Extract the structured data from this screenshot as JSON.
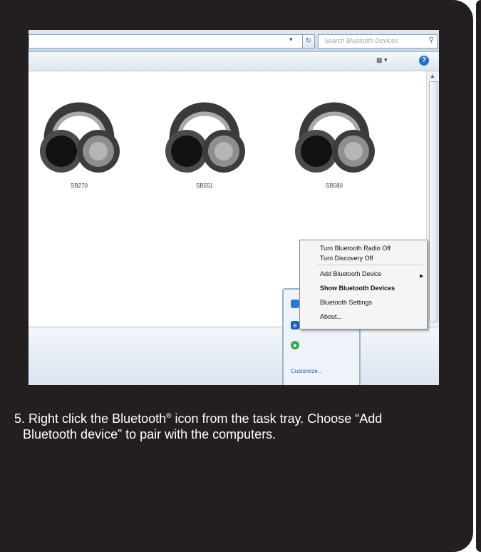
{
  "window": {
    "search_placeholder": "Search Bluetooth Devices",
    "devices": [
      {
        "name": "SB270"
      },
      {
        "name": "SB551"
      },
      {
        "name": "SB580"
      }
    ]
  },
  "context_menu": {
    "items": [
      {
        "label": "Turn Bluetooth Radio Off",
        "bold": false
      },
      {
        "label": "Turn Discovery Off",
        "bold": false
      },
      {
        "label": "Add Bluetooth Device",
        "bold": false,
        "submenu": true
      },
      {
        "label": "Show Bluetooth Devices",
        "bold": true
      },
      {
        "label": "Bluetooth Settings",
        "bold": false
      },
      {
        "label": "About...",
        "bold": false
      }
    ]
  },
  "tray": {
    "customize_label": "Customize..."
  },
  "instruction": {
    "step_number": "5.",
    "line1_before": "Right click the Bluetooth",
    "registered_mark": "®",
    "line1_after": " icon from the task tray.  Choose “Add",
    "line2": "Bluetooth device” to pair with the computers."
  },
  "colors": {
    "card_background": "#231f20",
    "caption_text": "#ffffff",
    "headphone_dark": "#3a3a3a",
    "headphone_light": "#9a9a9a"
  }
}
